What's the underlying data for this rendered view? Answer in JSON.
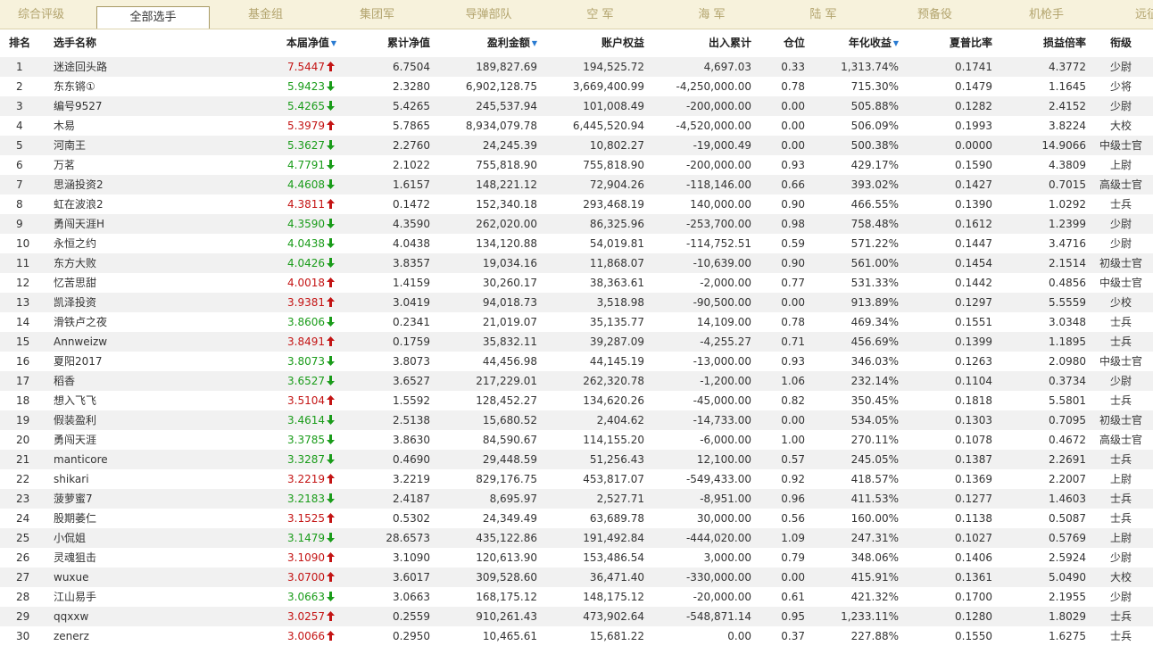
{
  "tabs": [
    {
      "label": "综合评级",
      "active": false
    },
    {
      "label": "全部选手",
      "active": true
    },
    {
      "label": "基金组",
      "active": false
    },
    {
      "label": "集团军",
      "active": false
    },
    {
      "label": "导弹部队",
      "active": false
    },
    {
      "label": "空 军",
      "active": false
    },
    {
      "label": "海 军",
      "active": false
    },
    {
      "label": "陆 军",
      "active": false
    },
    {
      "label": "预备役",
      "active": false
    },
    {
      "label": "机枪手",
      "active": false
    },
    {
      "label": "远征",
      "active": false
    }
  ],
  "columns": {
    "rank": "排名",
    "name": "选手名称",
    "nav": "本届净值",
    "cum_nav": "累计净值",
    "profit": "盈利金额",
    "equity": "账户权益",
    "flow": "出入累计",
    "position": "仓位",
    "annual": "年化收益",
    "sharpe": "夏普比率",
    "pl_ratio": "损益倍率",
    "title": "衔级"
  },
  "colors": {
    "up": "#c41414",
    "down": "#1a9c1a",
    "tab_bg": "#f7f2dc",
    "sort_icon": "#2a7bd1"
  },
  "rows": [
    {
      "rank": "1",
      "name": "迷途回头路",
      "nav": "7.5447",
      "dir": "up",
      "cum_nav": "6.7504",
      "profit": "189,827.69",
      "equity": "194,525.72",
      "flow": "4,697.03",
      "position": "0.33",
      "annual": "1,313.74%",
      "sharpe": "0.1741",
      "pl_ratio": "4.3772",
      "title": "少尉"
    },
    {
      "rank": "2",
      "name": "东东锵①",
      "nav": "5.9423",
      "dir": "down",
      "cum_nav": "2.3280",
      "profit": "6,902,128.75",
      "equity": "3,669,400.99",
      "flow": "-4,250,000.00",
      "position": "0.78",
      "annual": "715.30%",
      "sharpe": "0.1479",
      "pl_ratio": "1.1645",
      "title": "少将"
    },
    {
      "rank": "3",
      "name": "编号9527",
      "nav": "5.4265",
      "dir": "down",
      "cum_nav": "5.4265",
      "profit": "245,537.94",
      "equity": "101,008.49",
      "flow": "-200,000.00",
      "position": "0.00",
      "annual": "505.88%",
      "sharpe": "0.1282",
      "pl_ratio": "2.4152",
      "title": "少尉"
    },
    {
      "rank": "4",
      "name": "木易",
      "nav": "5.3979",
      "dir": "up",
      "cum_nav": "5.7865",
      "profit": "8,934,079.78",
      "equity": "6,445,520.94",
      "flow": "-4,520,000.00",
      "position": "0.00",
      "annual": "506.09%",
      "sharpe": "0.1993",
      "pl_ratio": "3.8224",
      "title": "大校"
    },
    {
      "rank": "5",
      "name": "河南王",
      "nav": "5.3627",
      "dir": "down",
      "cum_nav": "2.2760",
      "profit": "24,245.39",
      "equity": "10,802.27",
      "flow": "-19,000.49",
      "position": "0.00",
      "annual": "500.38%",
      "sharpe": "0.0000",
      "pl_ratio": "14.9066",
      "title": "中级士官"
    },
    {
      "rank": "6",
      "name": "万茗",
      "nav": "4.7791",
      "dir": "down",
      "cum_nav": "2.1022",
      "profit": "755,818.90",
      "equity": "755,818.90",
      "flow": "-200,000.00",
      "position": "0.93",
      "annual": "429.17%",
      "sharpe": "0.1590",
      "pl_ratio": "4.3809",
      "title": "上尉"
    },
    {
      "rank": "7",
      "name": "思涵投资2",
      "nav": "4.4608",
      "dir": "down",
      "cum_nav": "1.6157",
      "profit": "148,221.12",
      "equity": "72,904.26",
      "flow": "-118,146.00",
      "position": "0.66",
      "annual": "393.02%",
      "sharpe": "0.1427",
      "pl_ratio": "0.7015",
      "title": "高级士官"
    },
    {
      "rank": "8",
      "name": "虹在波浪2",
      "nav": "4.3811",
      "dir": "up",
      "cum_nav": "0.1472",
      "profit": "152,340.18",
      "equity": "293,468.19",
      "flow": "140,000.00",
      "position": "0.90",
      "annual": "466.55%",
      "sharpe": "0.1390",
      "pl_ratio": "1.0292",
      "title": "士兵"
    },
    {
      "rank": "9",
      "name": "勇闯天涯H",
      "nav": "4.3590",
      "dir": "down",
      "cum_nav": "4.3590",
      "profit": "262,020.00",
      "equity": "86,325.96",
      "flow": "-253,700.00",
      "position": "0.98",
      "annual": "758.48%",
      "sharpe": "0.1612",
      "pl_ratio": "1.2399",
      "title": "少尉"
    },
    {
      "rank": "10",
      "name": "永恒之约",
      "nav": "4.0438",
      "dir": "down",
      "cum_nav": "4.0438",
      "profit": "134,120.88",
      "equity": "54,019.81",
      "flow": "-114,752.51",
      "position": "0.59",
      "annual": "571.22%",
      "sharpe": "0.1447",
      "pl_ratio": "3.4716",
      "title": "少尉"
    },
    {
      "rank": "11",
      "name": "东方大败",
      "nav": "4.0426",
      "dir": "down",
      "cum_nav": "3.8357",
      "profit": "19,034.16",
      "equity": "11,868.07",
      "flow": "-10,639.00",
      "position": "0.90",
      "annual": "561.00%",
      "sharpe": "0.1454",
      "pl_ratio": "2.1514",
      "title": "初级士官"
    },
    {
      "rank": "12",
      "name": "忆苦思甜",
      "nav": "4.0018",
      "dir": "up",
      "cum_nav": "1.4159",
      "profit": "30,260.17",
      "equity": "38,363.61",
      "flow": "-2,000.00",
      "position": "0.77",
      "annual": "531.33%",
      "sharpe": "0.1442",
      "pl_ratio": "0.4856",
      "title": "中级士官"
    },
    {
      "rank": "13",
      "name": "凯泽投资",
      "nav": "3.9381",
      "dir": "up",
      "cum_nav": "3.0419",
      "profit": "94,018.73",
      "equity": "3,518.98",
      "flow": "-90,500.00",
      "position": "0.00",
      "annual": "913.89%",
      "sharpe": "0.1297",
      "pl_ratio": "5.5559",
      "title": "少校"
    },
    {
      "rank": "14",
      "name": "滑铁卢之夜",
      "nav": "3.8606",
      "dir": "down",
      "cum_nav": "0.2341",
      "profit": "21,019.07",
      "equity": "35,135.77",
      "flow": "14,109.00",
      "position": "0.78",
      "annual": "469.34%",
      "sharpe": "0.1551",
      "pl_ratio": "3.0348",
      "title": "士兵"
    },
    {
      "rank": "15",
      "name": "Annweizw",
      "nav": "3.8491",
      "dir": "up",
      "cum_nav": "0.1759",
      "profit": "35,832.11",
      "equity": "39,287.09",
      "flow": "-4,255.27",
      "position": "0.71",
      "annual": "456.69%",
      "sharpe": "0.1399",
      "pl_ratio": "1.1895",
      "title": "士兵"
    },
    {
      "rank": "16",
      "name": "夏阳2017",
      "nav": "3.8073",
      "dir": "down",
      "cum_nav": "3.8073",
      "profit": "44,456.98",
      "equity": "44,145.19",
      "flow": "-13,000.00",
      "position": "0.93",
      "annual": "346.03%",
      "sharpe": "0.1263",
      "pl_ratio": "2.0980",
      "title": "中级士官"
    },
    {
      "rank": "17",
      "name": "稻香",
      "nav": "3.6527",
      "dir": "down",
      "cum_nav": "3.6527",
      "profit": "217,229.01",
      "equity": "262,320.78",
      "flow": "-1,200.00",
      "position": "1.06",
      "annual": "232.14%",
      "sharpe": "0.1104",
      "pl_ratio": "0.3734",
      "title": "少尉"
    },
    {
      "rank": "18",
      "name": "想入飞飞",
      "nav": "3.5104",
      "dir": "up",
      "cum_nav": "1.5592",
      "profit": "128,452.27",
      "equity": "134,620.26",
      "flow": "-45,000.00",
      "position": "0.82",
      "annual": "350.45%",
      "sharpe": "0.1818",
      "pl_ratio": "5.5801",
      "title": "士兵"
    },
    {
      "rank": "19",
      "name": "假装盈利",
      "nav": "3.4614",
      "dir": "down",
      "cum_nav": "2.5138",
      "profit": "15,680.52",
      "equity": "2,404.62",
      "flow": "-14,733.00",
      "position": "0.00",
      "annual": "534.05%",
      "sharpe": "0.1303",
      "pl_ratio": "0.7095",
      "title": "初级士官"
    },
    {
      "rank": "20",
      "name": "勇闯天涯",
      "nav": "3.3785",
      "dir": "down",
      "cum_nav": "3.8630",
      "profit": "84,590.67",
      "equity": "114,155.20",
      "flow": "-6,000.00",
      "position": "1.00",
      "annual": "270.11%",
      "sharpe": "0.1078",
      "pl_ratio": "0.4672",
      "title": "高级士官"
    },
    {
      "rank": "21",
      "name": "manticore",
      "nav": "3.3287",
      "dir": "down",
      "cum_nav": "0.4690",
      "profit": "29,448.59",
      "equity": "51,256.43",
      "flow": "12,100.00",
      "position": "0.57",
      "annual": "245.05%",
      "sharpe": "0.1387",
      "pl_ratio": "2.2691",
      "title": "士兵"
    },
    {
      "rank": "22",
      "name": "shikari",
      "nav": "3.2219",
      "dir": "up",
      "cum_nav": "3.2219",
      "profit": "829,176.75",
      "equity": "453,817.07",
      "flow": "-549,433.00",
      "position": "0.92",
      "annual": "418.57%",
      "sharpe": "0.1369",
      "pl_ratio": "2.2007",
      "title": "上尉"
    },
    {
      "rank": "23",
      "name": "菠萝蜜7",
      "nav": "3.2183",
      "dir": "down",
      "cum_nav": "2.4187",
      "profit": "8,695.97",
      "equity": "2,527.71",
      "flow": "-8,951.00",
      "position": "0.96",
      "annual": "411.53%",
      "sharpe": "0.1277",
      "pl_ratio": "1.4603",
      "title": "士兵"
    },
    {
      "rank": "24",
      "name": "股期萎仁",
      "nav": "3.1525",
      "dir": "up",
      "cum_nav": "0.5302",
      "profit": "24,349.49",
      "equity": "63,689.78",
      "flow": "30,000.00",
      "position": "0.56",
      "annual": "160.00%",
      "sharpe": "0.1138",
      "pl_ratio": "0.5087",
      "title": "士兵"
    },
    {
      "rank": "25",
      "name": "小侃姐",
      "nav": "3.1479",
      "dir": "down",
      "cum_nav": "28.6573",
      "profit": "435,122.86",
      "equity": "191,492.84",
      "flow": "-444,020.00",
      "position": "1.09",
      "annual": "247.31%",
      "sharpe": "0.1027",
      "pl_ratio": "0.5769",
      "title": "上尉"
    },
    {
      "rank": "26",
      "name": "灵魂狙击",
      "nav": "3.1090",
      "dir": "up",
      "cum_nav": "3.1090",
      "profit": "120,613.90",
      "equity": "153,486.54",
      "flow": "3,000.00",
      "position": "0.79",
      "annual": "348.06%",
      "sharpe": "0.1406",
      "pl_ratio": "2.5924",
      "title": "少尉"
    },
    {
      "rank": "27",
      "name": "wuxue",
      "nav": "3.0700",
      "dir": "up",
      "cum_nav": "3.6017",
      "profit": "309,528.60",
      "equity": "36,471.40",
      "flow": "-330,000.00",
      "position": "0.00",
      "annual": "415.91%",
      "sharpe": "0.1361",
      "pl_ratio": "5.0490",
      "title": "大校"
    },
    {
      "rank": "28",
      "name": "江山易手",
      "nav": "3.0663",
      "dir": "down",
      "cum_nav": "3.0663",
      "profit": "168,175.12",
      "equity": "148,175.12",
      "flow": "-20,000.00",
      "position": "0.61",
      "annual": "421.32%",
      "sharpe": "0.1700",
      "pl_ratio": "2.1955",
      "title": "少尉"
    },
    {
      "rank": "29",
      "name": "qqxxw",
      "nav": "3.0257",
      "dir": "up",
      "cum_nav": "0.2559",
      "profit": "910,261.43",
      "equity": "473,902.64",
      "flow": "-548,871.14",
      "position": "0.95",
      "annual": "1,233.11%",
      "sharpe": "0.1280",
      "pl_ratio": "1.8029",
      "title": "士兵"
    },
    {
      "rank": "30",
      "name": "zenerz",
      "nav": "3.0066",
      "dir": "up",
      "cum_nav": "0.2950",
      "profit": "10,465.61",
      "equity": "15,681.22",
      "flow": "0.00",
      "position": "0.37",
      "annual": "227.88%",
      "sharpe": "0.1550",
      "pl_ratio": "1.6275",
      "title": "士兵"
    }
  ]
}
